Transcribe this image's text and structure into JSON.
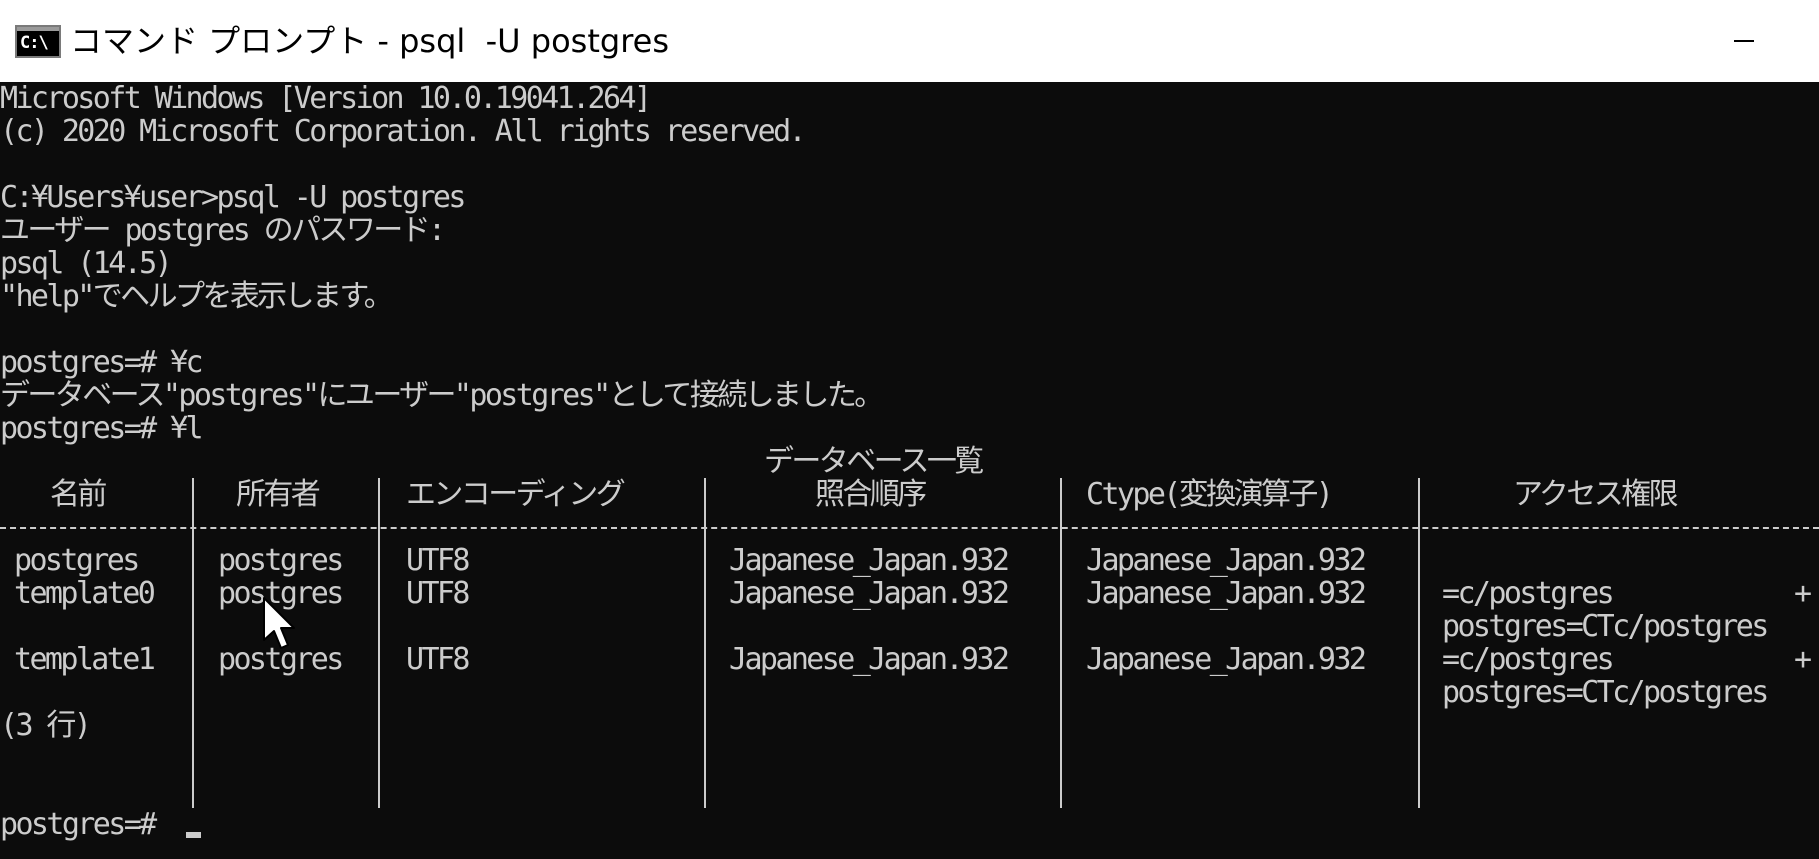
{
  "window": {
    "title": "コマンド プロンプト - psql  -U postgres",
    "app_icon": "cmd-icon",
    "app_icon_text": "C:\\",
    "controls": [
      "minimize-icon"
    ]
  },
  "console": {
    "lines": {
      "banner1": "Microsoft Windows [Version 10.0.19041.264]",
      "banner2": "(c) 2020 Microsoft Corporation. All rights reserved.",
      "command1": "C:¥Users¥user>psql -U postgres",
      "password_prompt": "ユーザー postgres のパスワード:",
      "psql_version": "psql (14.5)",
      "help_hint": "\"help\"でヘルプを表示します。",
      "command2": "postgres=# ¥c",
      "connected_msg": "データベース\"postgres\"にユーザー\"postgres\"として接続しました。",
      "command3": "postgres=# ¥l",
      "table_title": "データベース一覧",
      "row_count": "(3 行)",
      "final_prompt": "postgres=# "
    },
    "table": {
      "headers": [
        "名前",
        "所有者",
        "エンコーディング",
        "照合順序",
        "Ctype(変換演算子)",
        "アクセス権限"
      ],
      "rows": [
        {
          "name": "postgres",
          "owner": "postgres",
          "encoding": "UTF8",
          "collate": "Japanese_Japan.932",
          "ctype": "Japanese_Japan.932",
          "access1": "",
          "access2": ""
        },
        {
          "name": "template0",
          "owner": "postgres",
          "encoding": "UTF8",
          "collate": "Japanese_Japan.932",
          "ctype": "Japanese_Japan.932",
          "access1": "=c/postgres",
          "access2": "postgres=CTc/postgres"
        },
        {
          "name": "template1",
          "owner": "postgres",
          "encoding": "UTF8",
          "collate": "Japanese_Japan.932",
          "ctype": "Japanese_Japan.932",
          "access1": "=c/postgres",
          "access2": "postgres=CTc/postgres"
        }
      ],
      "continuation_mark": "+"
    }
  },
  "colors": {
    "console_bg": "#0c0c0c",
    "console_fg": "#cccccc",
    "titlebar_bg": "#ffffff"
  }
}
